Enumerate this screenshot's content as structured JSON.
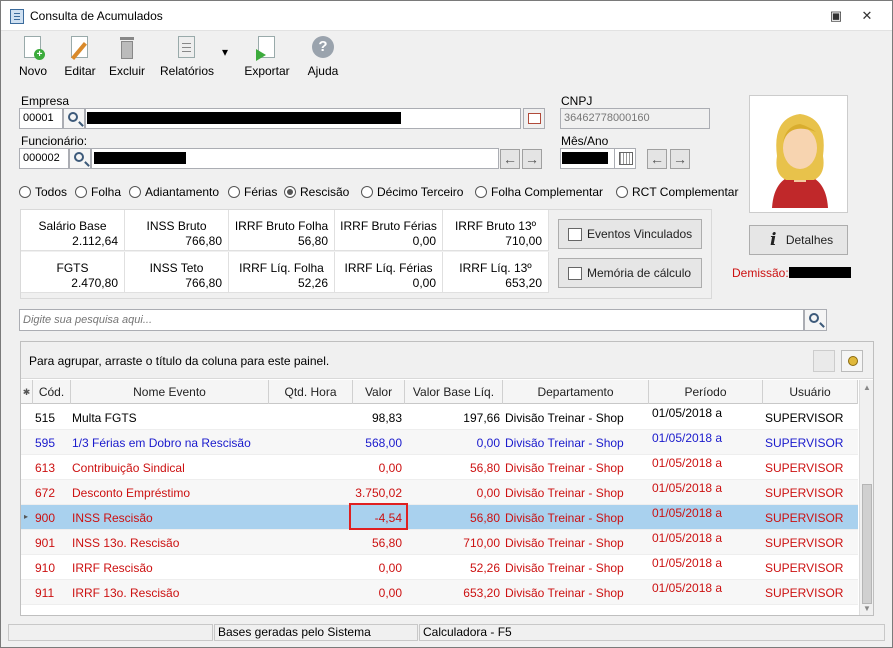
{
  "window": {
    "title": "Consulta de Acumulados"
  },
  "toolbar": {
    "novo": "Novo",
    "editar": "Editar",
    "excluir": "Excluir",
    "relatorios": "Relatórios",
    "exportar": "Exportar",
    "ajuda": "Ajuda"
  },
  "form": {
    "empresa_label": "Empresa",
    "empresa_code": "00001",
    "cnpj_label": "CNPJ",
    "cnpj_value": "36462778000160",
    "funcionario_label": "Funcionário:",
    "funcionario_code": "000002",
    "mesano_label": "Mês/Ano"
  },
  "filters": [
    "Todos",
    "Folha",
    "Adiantamento",
    "Férias",
    "Rescisão",
    "Décimo Terceiro",
    "Folha Complementar",
    "RCT Complementar"
  ],
  "filter_selected": "Rescisão",
  "summary": {
    "salario_base": {
      "k": "Salário Base",
      "v": "2.112,64"
    },
    "inss_bruto": {
      "k": "INSS Bruto",
      "v": "766,80"
    },
    "irrf_bruto_folha": {
      "k": "IRRF Bruto Folha",
      "v": "56,80"
    },
    "irrf_bruto_ferias": {
      "k": "IRRF Bruto Férias",
      "v": "0,00"
    },
    "irrf_bruto_13": {
      "k": "IRRF Bruto 13º",
      "v": "710,00"
    },
    "fgts": {
      "k": "FGTS",
      "v": "2.470,80"
    },
    "inss_teto": {
      "k": "INSS Teto",
      "v": "766,80"
    },
    "irrf_liq_folha": {
      "k": "IRRF Líq. Folha",
      "v": "52,26"
    },
    "irrf_liq_ferias": {
      "k": "IRRF Líq. Férias",
      "v": "0,00"
    },
    "irrf_liq_13": {
      "k": "IRRF Líq. 13º",
      "v": "653,20"
    }
  },
  "buttons": {
    "eventos": "Eventos Vinculados",
    "memoria": "Memória de cálculo",
    "detalhes": "Detalhes"
  },
  "demissao_label": "Demissão:",
  "search": {
    "placeholder": "Digite sua pesquisa aqui..."
  },
  "grid": {
    "group_hint": "Para agrupar, arraste o título da coluna para este painel.",
    "columns": [
      "Cód.",
      "Nome Evento",
      "Qtd. Hora",
      "Valor",
      "Valor Base Líq.",
      "Departamento",
      "Período",
      "Usuário"
    ],
    "rows": [
      {
        "cod": "515",
        "nome": "Multa FGTS",
        "qtd": "",
        "valor": "98,83",
        "base": "197,66",
        "depto": "Divisão Treinar - Shop",
        "periodo": "01/05/2018 a",
        "usuario": "SUPERVISOR",
        "color": "#000000"
      },
      {
        "cod": "595",
        "nome": "1/3 Férias em Dobro na Rescisão",
        "qtd": "",
        "valor": "568,00",
        "base": "0,00",
        "depto": "Divisão Treinar - Shop",
        "periodo": "01/05/2018 a",
        "usuario": "SUPERVISOR",
        "color": "#1a1acc"
      },
      {
        "cod": "613",
        "nome": "Contribuição Sindical",
        "qtd": "",
        "valor": "0,00",
        "base": "56,80",
        "depto": "Divisão Treinar - Shop",
        "periodo": "01/05/2018 a",
        "usuario": "SUPERVISOR",
        "color": "#cc1111"
      },
      {
        "cod": "672",
        "nome": "Desconto Empréstimo",
        "qtd": "",
        "valor": "3.750,02",
        "base": "0,00",
        "depto": "Divisão Treinar - Shop",
        "periodo": "01/05/2018 a",
        "usuario": "SUPERVISOR",
        "color": "#cc1111"
      },
      {
        "cod": "900",
        "nome": "INSS  Rescisão",
        "qtd": "",
        "valor": "-4,54",
        "base": "56,80",
        "depto": "Divisão Treinar - Shop",
        "periodo": "01/05/2018 a",
        "usuario": "SUPERVISOR",
        "color": "#cc1111"
      },
      {
        "cod": "901",
        "nome": "INSS 13o. Rescisão",
        "qtd": "",
        "valor": "56,80",
        "base": "710,00",
        "depto": "Divisão Treinar - Shop",
        "periodo": "01/05/2018 a",
        "usuario": "SUPERVISOR",
        "color": "#cc1111"
      },
      {
        "cod": "910",
        "nome": "IRRF Rescisão",
        "qtd": "",
        "valor": "0,00",
        "base": "52,26",
        "depto": "Divisão Treinar - Shop",
        "periodo": "01/05/2018 a",
        "usuario": "SUPERVISOR",
        "color": "#cc1111"
      },
      {
        "cod": "911",
        "nome": "IRRF 13o. Rescisão",
        "qtd": "",
        "valor": "0,00",
        "base": "653,20",
        "depto": "Divisão Treinar - Shop",
        "periodo": "01/05/2018 a",
        "usuario": "SUPERVISOR",
        "color": "#cc1111"
      }
    ],
    "selected_row": 4
  },
  "statusbar": {
    "s1": "",
    "s2": "Bases geradas pelo Sistema",
    "s3": "Calculadora - F5"
  }
}
